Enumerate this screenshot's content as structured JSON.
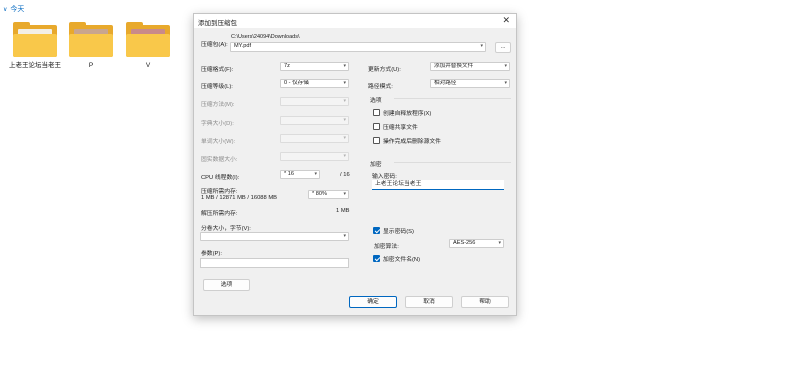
{
  "explorer": {
    "group_label": "今天",
    "files": [
      {
        "name": "上老王论坛当老王",
        "paper": "#f3efe6"
      },
      {
        "name": "P",
        "paper": "#c9a58e"
      },
      {
        "name": "V",
        "paper": "#c98a8a"
      }
    ]
  },
  "dialog": {
    "title": "添加到压缩包",
    "archive_label": "压缩包(A):",
    "archive_dir": "C:\\Users\\24094\\Downloads\\",
    "archive_name": "MY.pdf",
    "browse_label": "...",
    "format_label": "压缩格式(F):",
    "format_value": "7z",
    "level_label": "压缩等级(L):",
    "level_value": "0 - 仅存储",
    "method_label": "压缩方法(M):",
    "dict_label": "字典大小(D):",
    "word_label": "单词大小(W):",
    "solid_label": "固实数据大小:",
    "cpu_label": "CPU 线程数(I):",
    "cpu_value": "* 16",
    "cpu_total": "/ 16",
    "mem_label": "压缩所需内存:",
    "mem_detail": "1 MB / 12871 MB / 16088 MB",
    "mem_percent": "* 80%",
    "decomp_label": "解压所需内存:",
    "decomp_value": "1 MB",
    "split_label": "分卷大小，字节(V):",
    "params_label": "参数(P):",
    "options_button": "选项",
    "update_label": "更新方式(U):",
    "update_value": "添加并替换文件",
    "path_label": "路径模式:",
    "path_value": "相对路径",
    "options_title": "选项",
    "opt_sfx": "创建自释放程序(X)",
    "opt_shared": "压缩共享文件",
    "opt_delete": "操作完成后删除源文件",
    "encrypt_title": "加密",
    "password_label": "输入密码:",
    "password_value": "上老王论坛当老王",
    "show_password": "显示密码(S)",
    "enc_method_label": "加密算法:",
    "enc_method_value": "AES-256",
    "encrypt_names": "加密文件名(N)",
    "ok": "确定",
    "cancel": "取消",
    "help": "帮助"
  }
}
